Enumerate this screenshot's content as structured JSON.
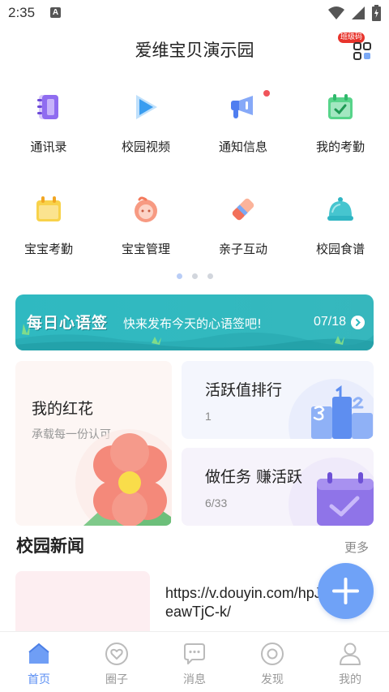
{
  "status_bar": {
    "time": "2:35",
    "notification_letter": "A"
  },
  "header": {
    "title": "爱维宝贝演示园",
    "class_code_badge": "班级码"
  },
  "features": [
    {
      "label": "通讯录",
      "icon": "contacts-book-icon"
    },
    {
      "label": "校园视频",
      "icon": "play-video-icon"
    },
    {
      "label": "通知信息",
      "icon": "megaphone-icon",
      "has_red_dot": true
    },
    {
      "label": "我的考勤",
      "icon": "calendar-check-icon"
    },
    {
      "label": "宝宝考勤",
      "icon": "baby-attendance-icon"
    },
    {
      "label": "宝宝管理",
      "icon": "baby-face-icon"
    },
    {
      "label": "亲子互动",
      "icon": "eraser-icon"
    },
    {
      "label": "校园食谱",
      "icon": "cloche-food-icon"
    }
  ],
  "pager": {
    "count": 3,
    "active": 0
  },
  "banner": {
    "title": "每日心语签",
    "subtitle": "快来发布今天的心语签吧!",
    "date": "07/18"
  },
  "cards": {
    "flower": {
      "title": "我的红花",
      "subtitle": "承载每一份认可"
    },
    "rank": {
      "title": "活跃值排行",
      "value": "1"
    },
    "task": {
      "title": "做任务 赚活跃",
      "value": "6/33"
    }
  },
  "news": {
    "title": "校园新闻",
    "more": "更多",
    "item_text": "https://v.douyin.com/hpJeawTjC-k/"
  },
  "tabs": [
    {
      "label": "首页",
      "icon": "home-icon",
      "active": true
    },
    {
      "label": "圈子",
      "icon": "heart-circle-icon",
      "active": false
    },
    {
      "label": "消息",
      "icon": "chat-bubble-icon",
      "active": false
    },
    {
      "label": "发现",
      "icon": "eye-icon",
      "active": false
    },
    {
      "label": "我的",
      "icon": "person-icon",
      "active": false
    }
  ],
  "colors": {
    "accent": "#5a8ef3",
    "banner": "#32b9bf",
    "red_dot": "#f0545a"
  }
}
